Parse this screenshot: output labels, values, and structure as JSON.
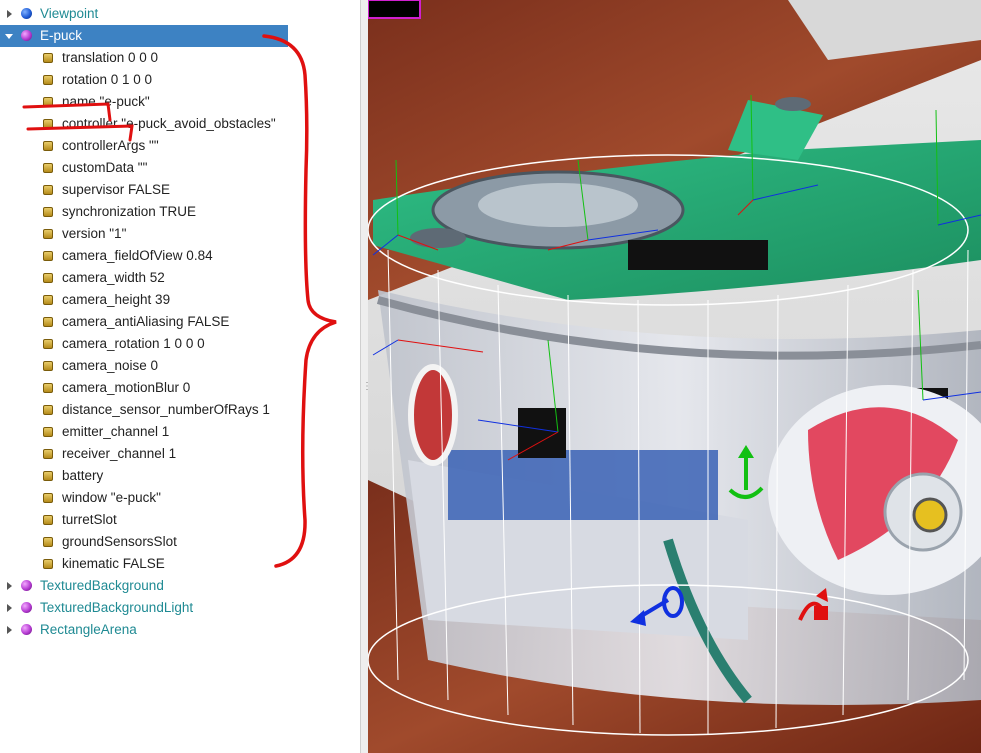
{
  "scene_tree": {
    "nodes_before": [
      {
        "label": "Viewpoint",
        "icon": "blue-sphere-icon"
      }
    ],
    "selected_node": {
      "label": "E-puck",
      "icon": "purple-sphere-icon",
      "expanded": true
    },
    "fields": [
      "translation 0 0 0",
      "rotation 0 1 0 0",
      "name \"e-puck\"",
      "controller \"e-puck_avoid_obstacles\"",
      "controllerArgs \"\"",
      "customData \"\"",
      "supervisor FALSE",
      "synchronization TRUE",
      "version \"1\"",
      "camera_fieldOfView 0.84",
      "camera_width 52",
      "camera_height 39",
      "camera_antiAliasing FALSE",
      "camera_rotation 1 0 0 0",
      "camera_noise 0",
      "camera_motionBlur 0",
      "distance_sensor_numberOfRays 1",
      "emitter_channel 1",
      "receiver_channel 1",
      "battery",
      "window \"e-puck\"",
      "turretSlot",
      "groundSensorsSlot",
      "kinematic FALSE"
    ],
    "nodes_after": [
      {
        "label": "TexturedBackground",
        "icon": "purple-sphere-icon"
      },
      {
        "label": "TexturedBackgroundLight",
        "icon": "purple-sphere-icon"
      },
      {
        "label": "RectangleArena",
        "icon": "purple-sphere-icon"
      }
    ]
  },
  "colors": {
    "selection": "#3d82c3",
    "node_text": "#1f8a93",
    "annotation": "#e01010"
  },
  "viewport": {
    "subject": "e-puck robot 3D view",
    "gizmo_colors": {
      "x": "#e01010",
      "y": "#12c012",
      "z": "#1030e0"
    }
  }
}
